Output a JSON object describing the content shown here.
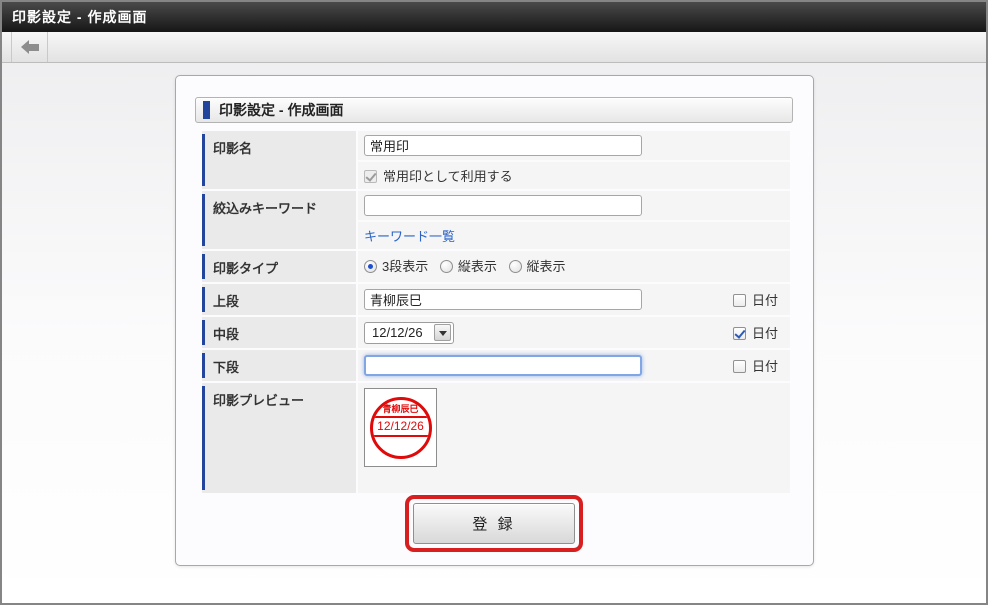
{
  "title_bar": {
    "title": "印影設定 - 作成画面"
  },
  "toolbar": {
    "back_icon": "arrow-left"
  },
  "panel": {
    "header_title": "印影設定 - 作成画面",
    "rows": {
      "seal_name": {
        "label": "印影名",
        "value": "常用印",
        "common_checkbox_label": "常用印として利用する",
        "common_checkbox_checked": true,
        "common_checkbox_disabled": true
      },
      "keyword": {
        "label": "絞込みキーワード",
        "value": "",
        "link_label": "キーワード一覧"
      },
      "seal_type": {
        "label": "印影タイプ",
        "options": [
          {
            "label": "3段表示",
            "selected": true
          },
          {
            "label": "縦表示",
            "selected": false
          },
          {
            "label": "縦表示",
            "selected": false
          }
        ]
      },
      "upper": {
        "label": "上段",
        "value": "青柳辰巳",
        "date_label": "日付",
        "date_checked": false
      },
      "middle": {
        "label": "中段",
        "value": "12/12/26",
        "date_label": "日付",
        "date_checked": true
      },
      "lower": {
        "label": "下段",
        "value": "",
        "date_label": "日付",
        "date_checked": false,
        "focused": true
      },
      "preview": {
        "label": "印影プレビュー",
        "stamp": {
          "top_text": "青柳辰巳",
          "middle_text": "12/12/26",
          "color": "#e00a0a"
        }
      }
    },
    "submit": {
      "label": "登 録",
      "highlighted": true,
      "highlight_color": "#d81e1e"
    }
  },
  "colors": {
    "accent_blue": "#24459c",
    "link_blue": "#2a64c8",
    "stamp_red": "#e00a0a",
    "annotation_red": "#d81e1e",
    "titlebar_bg": "#1a1a1a"
  }
}
